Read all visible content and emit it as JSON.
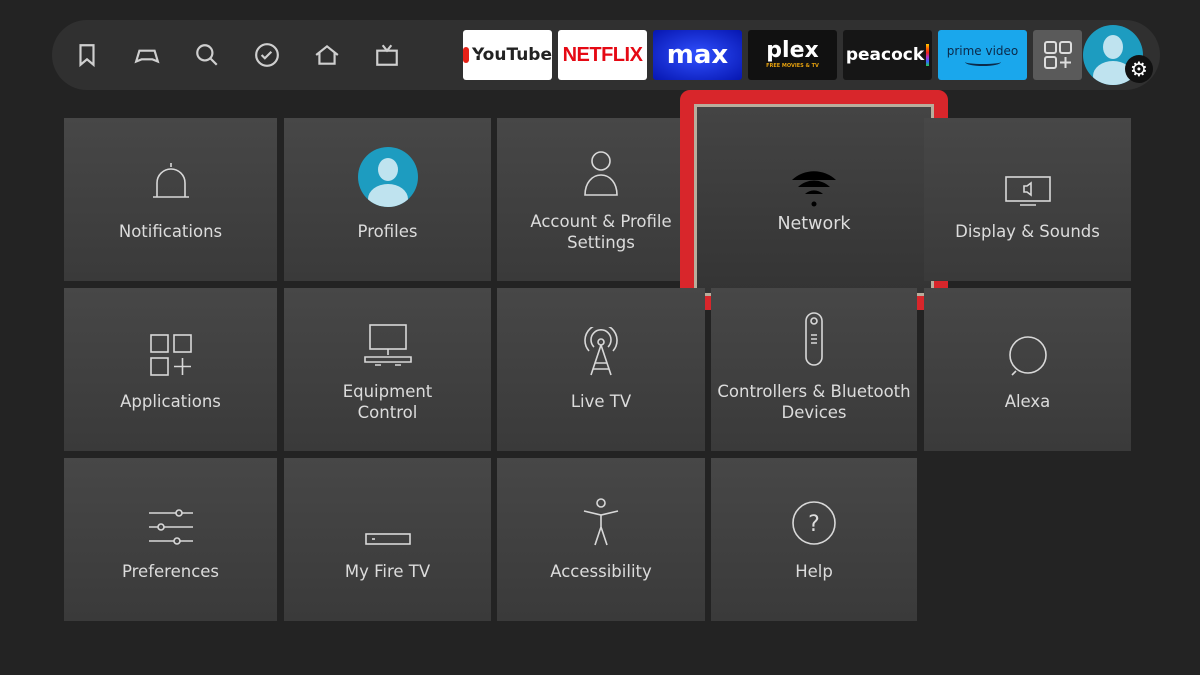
{
  "nav_icons": [
    "bookmark-icon",
    "gamepad-icon",
    "search-icon",
    "check-circle-icon",
    "home-icon",
    "live-tv-icon"
  ],
  "apps": [
    {
      "name": "YouTube",
      "bg": "#ffffff",
      "color": "#222"
    },
    {
      "name": "NETFLIX",
      "bg": "#ffffff",
      "color": "#e50914"
    },
    {
      "name": "max",
      "bg": "#0a23d8",
      "color": "#ffffff"
    },
    {
      "name": "plex",
      "sub": "FREE MOVIES & TV",
      "bg": "#111111",
      "color": "#ffffff"
    },
    {
      "name": "peacock",
      "bg": "#161616",
      "color": "#ffffff"
    },
    {
      "name": "prime video",
      "bg": "#1aa7ec",
      "color": "#0c2a4a"
    }
  ],
  "tiles": [
    {
      "label": "Notifications",
      "icon": "bell-icon"
    },
    {
      "label": "Profiles",
      "icon": "profile-avatar-icon"
    },
    {
      "label": "Account & Profile\nSettings",
      "icon": "person-icon"
    },
    {
      "label": "Network",
      "icon": "wifi-icon",
      "focused": true
    },
    {
      "label": "Display & Sounds",
      "icon": "display-icon"
    },
    {
      "label": "Applications",
      "icon": "apps-grid-icon"
    },
    {
      "label": "Equipment\nControl",
      "icon": "equipment-icon"
    },
    {
      "label": "Live TV",
      "icon": "antenna-icon"
    },
    {
      "label": "Controllers & Bluetooth\nDevices",
      "icon": "remote-icon"
    },
    {
      "label": "Alexa",
      "icon": "alexa-icon"
    },
    {
      "label": "Preferences",
      "icon": "sliders-icon"
    },
    {
      "label": "My Fire TV",
      "icon": "firetv-device-icon"
    },
    {
      "label": "Accessibility",
      "icon": "accessibility-icon"
    },
    {
      "label": "Help",
      "icon": "help-icon"
    }
  ],
  "colors": {
    "focus": "#d8262b",
    "background": "#232323",
    "tile": "#424242"
  }
}
